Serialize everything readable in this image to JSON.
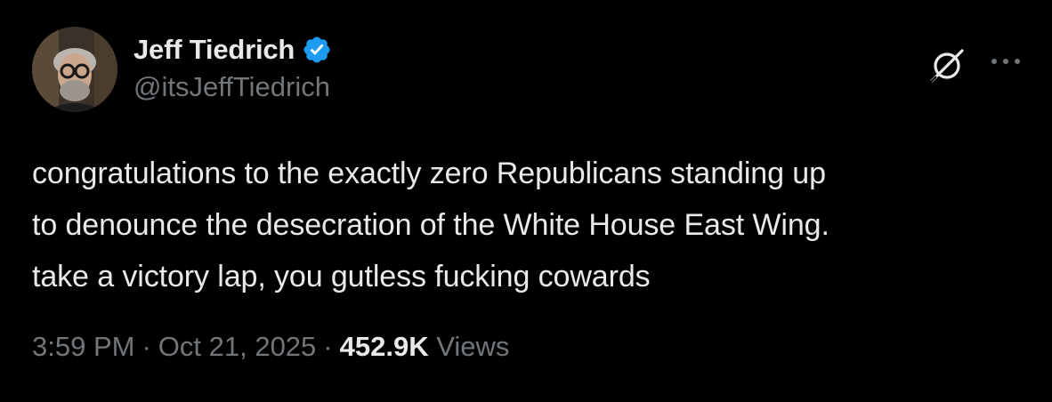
{
  "author": {
    "display_name": "Jeff Tiedrich",
    "handle": "@itsJeffTiedrich",
    "verified_color": "#1d9bf0"
  },
  "icons": {
    "verified": "verified-badge-icon",
    "grok": "grok-icon",
    "more": "more-options-icon"
  },
  "tweet": {
    "lines": [
      "congratulations to the exactly zero Republicans standing up",
      "to denounce the desecration of the White House East Wing.",
      "take a victory lap, you gutless fucking cowards"
    ]
  },
  "meta": {
    "time": "3:59 PM",
    "separator": "·",
    "date": "Oct 21, 2025",
    "views_count": "452.9K",
    "views_label": "Views"
  },
  "colors": {
    "background": "#000000",
    "text": "#e7e9ea",
    "secondary": "#71767b",
    "accent": "#1d9bf0"
  }
}
